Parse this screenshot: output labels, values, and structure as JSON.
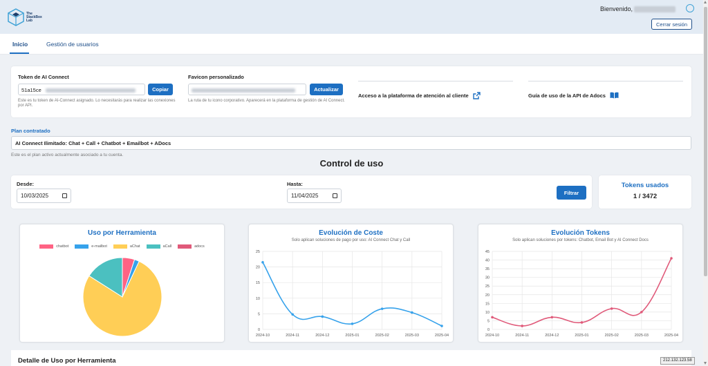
{
  "header": {
    "logo_text": [
      "The",
      "StackBox",
      "Lab"
    ],
    "welcome": "Bienvenido,",
    "logout_label": "Cerrar sesión"
  },
  "tabs": [
    {
      "label": "Inicio",
      "active": true
    },
    {
      "label": "Gestión de usuarios",
      "active": false
    }
  ],
  "config": {
    "token": {
      "label": "Token de AI Connect",
      "value": "51a15ce",
      "copy_label": "Copiar",
      "help": "Este es tu token de AI-Connect asignado. Lo necesitarás para realizar las conexiones por API."
    },
    "favicon": {
      "label": "Favicon personalizado",
      "update_label": "Actualizar",
      "help": "La ruta de tu icono corporativo. Aparecerá en la plataforma de gestión de AI Connect."
    },
    "links": [
      {
        "label": "Acceso a la plataforma de atención al cliente",
        "icon": "external-link-icon"
      },
      {
        "label": "Guía de uso de la API de Adocs",
        "icon": "book-icon"
      }
    ]
  },
  "plan": {
    "label": "Plan contratado",
    "value": "AI Connect Ilimitado: Chat + Call + Chatbot + Emailbot + ADocs",
    "help": "Este es el plan activo actualmente asociado a tu cuenta."
  },
  "usage": {
    "title": "Control de uso",
    "from_label": "Desde:",
    "from_value": "10/03/2025",
    "to_label": "Hasta:",
    "to_value": "11/04/2025",
    "filter_label": "Filtrar",
    "tokens_title": "Tokens usados",
    "tokens_value": "1 / 3472"
  },
  "chart_data": [
    {
      "type": "pie",
      "title": "Uso por Herramienta",
      "labels": [
        "chatbot",
        "e-mailbot",
        "aChat",
        "aCall",
        "adocs"
      ],
      "colors": [
        "#ff6384",
        "#36a2eb",
        "#ffce56",
        "#4bc0c0",
        "#e05a7a"
      ],
      "values": [
        5,
        2,
        77,
        16,
        0
      ]
    },
    {
      "type": "line",
      "title": "Evolución de Coste",
      "subtitle": "Solo aplican soluciones de pago por uso: AI Connect Chat y Call",
      "x": [
        "2024-10",
        "2024-11",
        "2024-12",
        "2025-01",
        "2025-02",
        "2025-03",
        "2025-04"
      ],
      "values": [
        21.5,
        4.8,
        4.1,
        1.8,
        6.6,
        5.4,
        1.1
      ],
      "ylim": [
        0,
        25
      ],
      "yticks": [
        0,
        5,
        10,
        15,
        20,
        25
      ],
      "color": "#36a2eb",
      "grid": true
    },
    {
      "type": "line",
      "title": "Evolución Tokens",
      "subtitle": "Solo aplican soluciones por tokens: Chatbot, Email Bot y AI Connect Docs",
      "x": [
        "2024-10",
        "2024-11",
        "2024-12",
        "2025-01",
        "2025-02",
        "2025-03",
        "2025-04"
      ],
      "values": [
        7,
        2,
        7,
        4,
        12,
        10,
        41
      ],
      "ylim": [
        0,
        45
      ],
      "yticks": [
        0,
        5,
        10,
        15,
        20,
        25,
        30,
        35,
        40,
        45
      ],
      "color": "#e05a7a",
      "grid": true
    }
  ],
  "detail": {
    "title": "Detalle de Uso por Herramienta"
  },
  "ip_badge": "212.132.123.58"
}
